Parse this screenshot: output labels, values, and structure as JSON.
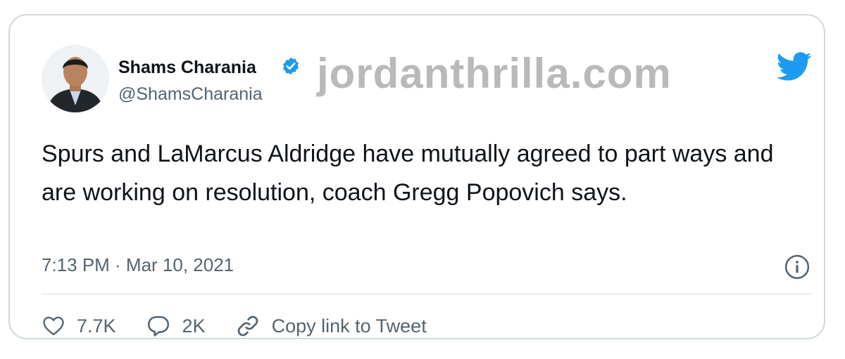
{
  "tweet": {
    "author": {
      "name": "Shams Charania",
      "handle": "@ShamsCharania"
    },
    "text": "Spurs and LaMarcus Aldridge have mutually agreed to part ways and are working on resolution, coach Gregg Popovich says.",
    "timestamp": "7:13 PM · Mar 10, 2021",
    "actions": {
      "likes": "7.7K",
      "replies": "2K",
      "copy_link": "Copy link to Tweet"
    }
  },
  "watermark": "jordanthrilla.com",
  "colors": {
    "twitter_blue": "#1d9bf0",
    "text": "#0f1419",
    "secondary": "#536471",
    "border": "#cfd9de"
  },
  "icons": [
    "verified-badge-icon",
    "twitter-bird-icon",
    "info-icon",
    "heart-icon",
    "reply-icon",
    "link-icon"
  ]
}
